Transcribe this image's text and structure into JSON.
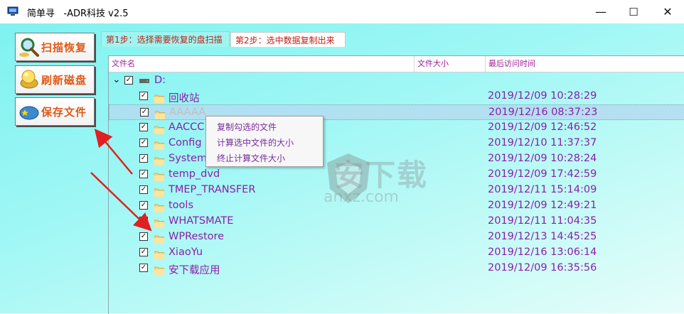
{
  "window": {
    "title": "简单寻   -ADR科技 v2.5",
    "minimize_glyph": "—",
    "maximize_glyph": "☐",
    "close_glyph": "✕"
  },
  "left_buttons": [
    {
      "label": "扫描恢复",
      "icon": "magnifier-icon"
    },
    {
      "label": "刷新磁盘",
      "icon": "refresh-disk-icon"
    },
    {
      "label": "保存文件",
      "icon": "save-file-icon"
    }
  ],
  "tabs": [
    {
      "label": "第1步：选择需要恢复的盘扫描",
      "active": true
    },
    {
      "label": "第2步：选中数据复制出来",
      "active": false
    }
  ],
  "columns": [
    "文件名",
    "文件大小",
    "最后访问时间"
  ],
  "drive": {
    "label": "D:",
    "checked": true,
    "expanded": true
  },
  "rows": [
    {
      "name": "回收站",
      "date": "2019/12/09 10:28:29",
      "checked": true,
      "selected": false
    },
    {
      "name": "AAAAA",
      "date": "2019/12/16 08:37:23",
      "checked": true,
      "selected": true
    },
    {
      "name": "AACCC",
      "date": "2019/12/09 12:46:52",
      "checked": true,
      "selected": false
    },
    {
      "name": "Config",
      "date": "2019/12/10 11:37:37",
      "checked": true,
      "selected": false
    },
    {
      "name": "System",
      "date": "2019/12/09 10:28:24",
      "checked": true,
      "selected": false
    },
    {
      "name": "temp_dvd",
      "date": "2019/12/09 17:42:59",
      "checked": true,
      "selected": false
    },
    {
      "name": "TMEP_TRANSFER",
      "date": "2019/12/11 15:14:09",
      "checked": true,
      "selected": false
    },
    {
      "name": "tools",
      "date": "2019/12/09 12:49:21",
      "checked": true,
      "selected": false
    },
    {
      "name": "WHATSMATE",
      "date": "2019/12/11 11:04:35",
      "checked": true,
      "selected": false
    },
    {
      "name": "WPRestore",
      "date": "2019/12/13 14:45:25",
      "checked": true,
      "selected": false
    },
    {
      "name": "XiaoYu",
      "date": "2019/12/16 13:06:14",
      "checked": true,
      "selected": false
    },
    {
      "name": "安下载应用",
      "date": "2019/12/09 16:35:56",
      "checked": true,
      "selected": false
    }
  ],
  "context_menu": [
    "复制勾选的文件",
    "计算选中文件的大小",
    "终止计算文件大小"
  ],
  "watermark": {
    "text": "安下载",
    "sub": "anxz.com"
  },
  "colors": {
    "background": "#9ff7f5",
    "text": "#8b1fa8",
    "button_text": "#e05a18",
    "tab_text": "#c0201a",
    "arrow": "#e02020"
  }
}
